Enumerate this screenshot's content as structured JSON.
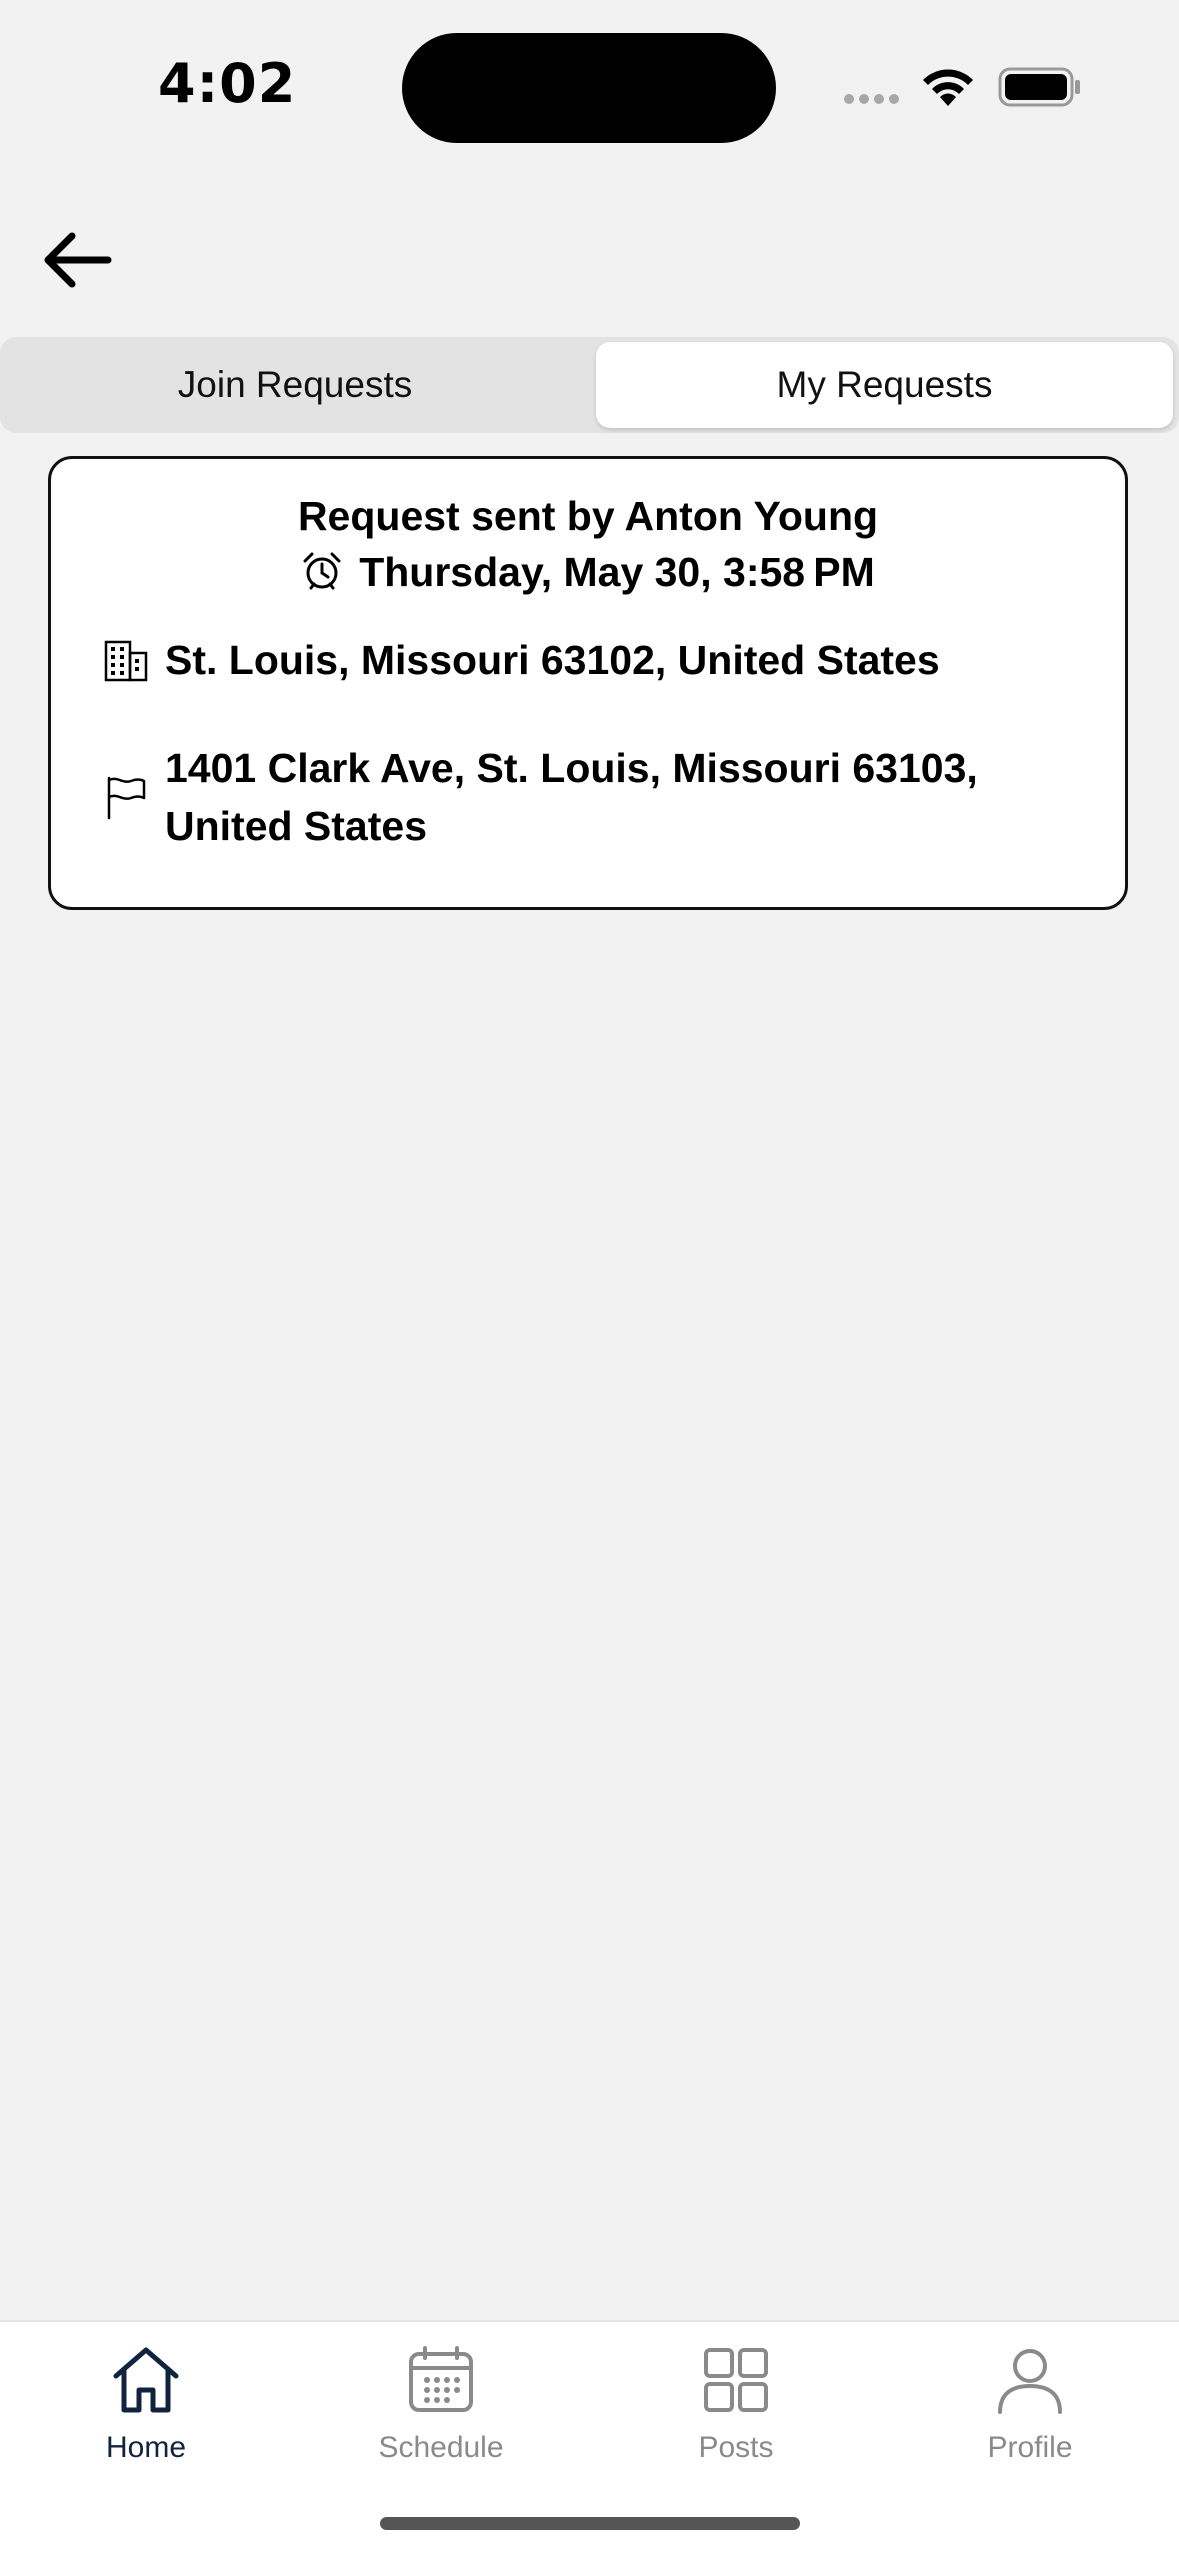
{
  "status_bar": {
    "time": "4:02"
  },
  "segmented": {
    "join_label": "Join Requests",
    "mine_label": "My Requests",
    "selected": "My Requests"
  },
  "request_card": {
    "title": "Request sent by Anton Young",
    "time": "Thursday, May 30, 3:58 PM",
    "origin": "St. Louis, Missouri 63102, United States",
    "destination": "1401 Clark Ave, St. Louis, Missouri 63103, United States"
  },
  "tab_bar": {
    "items": [
      {
        "label": "Home",
        "icon": "home-icon",
        "active": true
      },
      {
        "label": "Schedule",
        "icon": "calendar-icon",
        "active": false
      },
      {
        "label": "Posts",
        "icon": "grid-icon",
        "active": false
      },
      {
        "label": "Profile",
        "icon": "person-icon",
        "active": false
      }
    ]
  },
  "colors": {
    "background": "#f2f2f2",
    "active_tab": "#10243e",
    "inactive_tab": "#8a8a8a",
    "card_border": "#111111"
  }
}
